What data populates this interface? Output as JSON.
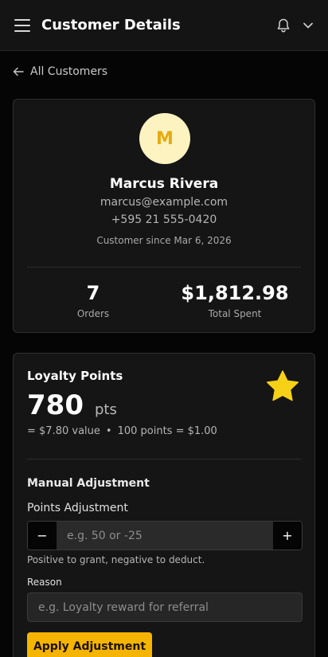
{
  "header": {
    "title": "Customer Details",
    "icons": [
      "menu-icon",
      "bell-icon",
      "chevron-down-icon"
    ]
  },
  "nav": {
    "back_label": "All Customers"
  },
  "customer": {
    "avatar_initial": "M",
    "name": "Marcus Rivera",
    "email": "marcus@example.com",
    "phone": "+595 21 555-0420",
    "since": "Customer since Mar 6, 2026",
    "stats": {
      "orders_value": "7",
      "orders_label": "Orders",
      "spent_value": "$1,812.98",
      "spent_label": "Total Spent"
    }
  },
  "loyalty": {
    "title": "Loyalty Points",
    "points": "780",
    "unit": "pts",
    "value_text": "= $7.80 value",
    "separator": "•",
    "rate_text": "100 points = $1.00",
    "adjustment": {
      "section_title": "Manual Adjustment",
      "points_label": "Points Adjustment",
      "decrement_label": "−",
      "increment_label": "+",
      "points_value": "",
      "points_placeholder": "e.g. 50 or -25",
      "help_text": "Positive to grant, negative to deduct.",
      "reason_label": "Reason",
      "reason_value": "",
      "reason_placeholder": "e.g. Loyalty reward for referral",
      "apply_label": "Apply Adjustment"
    }
  },
  "colors": {
    "accent": "#f5b400",
    "avatar_bg": "#fdf3c0",
    "avatar_text": "#e6ab12",
    "star": "#f7d117",
    "background": "#050505",
    "card": "#151515"
  }
}
